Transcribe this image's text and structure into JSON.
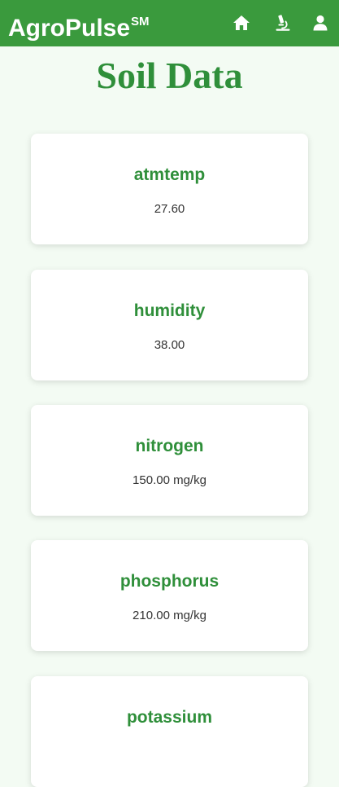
{
  "header": {
    "brand": "AgroPulse",
    "brand_mark": "SM",
    "icons": [
      "home-icon",
      "microscope-icon",
      "user-icon"
    ]
  },
  "page": {
    "title": "Soil Data"
  },
  "cards": [
    {
      "label": "atmtemp",
      "value": "27.60"
    },
    {
      "label": "humidity",
      "value": "38.00"
    },
    {
      "label": "nitrogen",
      "value": "150.00 mg/kg"
    },
    {
      "label": "phosphorus",
      "value": "210.00 mg/kg"
    },
    {
      "label": "potassium",
      "value": ""
    }
  ],
  "colors": {
    "header_bg": "#3a9a3d",
    "accent_green": "#2f8f3a",
    "page_bg": "#f3fbf3",
    "card_bg": "#ffffff",
    "value_text": "#333333"
  }
}
